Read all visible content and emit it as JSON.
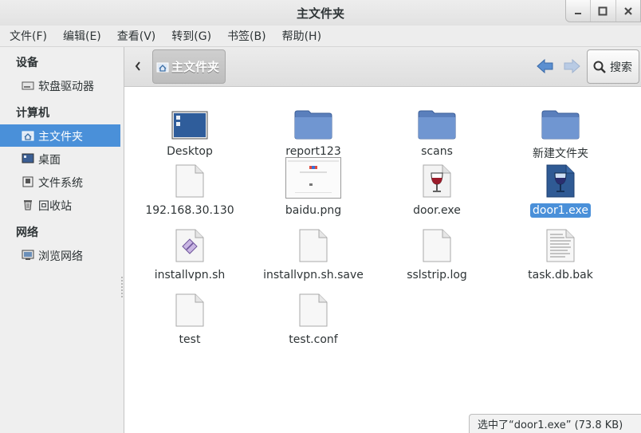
{
  "window": {
    "title": "主文件夹"
  },
  "menubar": [
    "文件(F)",
    "编辑(E)",
    "查看(V)",
    "转到(G)",
    "书签(B)",
    "帮助(H)"
  ],
  "sidebar": {
    "sections": [
      {
        "heading": "设备",
        "items": [
          {
            "label": "软盘驱动器",
            "icon": "floppy-drive-icon"
          }
        ]
      },
      {
        "heading": "计算机",
        "items": [
          {
            "label": "主文件夹",
            "icon": "home-folder-icon",
            "selected": true
          },
          {
            "label": "桌面",
            "icon": "desktop-icon"
          },
          {
            "label": "文件系统",
            "icon": "filesystem-icon"
          },
          {
            "label": "回收站",
            "icon": "trash-icon"
          }
        ]
      },
      {
        "heading": "网络",
        "items": [
          {
            "label": "浏览网络",
            "icon": "network-icon"
          }
        ]
      }
    ]
  },
  "location": {
    "path_label": "主文件夹",
    "search_label": "搜索"
  },
  "files": [
    {
      "name": "Desktop",
      "icon": "desktop-folder-icon"
    },
    {
      "name": "report123",
      "icon": "folder-icon"
    },
    {
      "name": "scans",
      "icon": "folder-icon"
    },
    {
      "name": "新建文件夹",
      "icon": "folder-icon"
    },
    {
      "name": "192.168.30.130",
      "icon": "blank-file-icon"
    },
    {
      "name": "baidu.png",
      "icon": "image-thumbnail-icon"
    },
    {
      "name": "door.exe",
      "icon": "wine-exe-icon"
    },
    {
      "name": "door1.exe",
      "icon": "wine-exe-icon",
      "selected": true
    },
    {
      "name": "installvpn.sh",
      "icon": "script-file-icon"
    },
    {
      "name": "installvpn.sh.save",
      "icon": "blank-file-icon"
    },
    {
      "name": "sslstrip.log",
      "icon": "blank-file-icon"
    },
    {
      "name": "task.db.bak",
      "icon": "text-file-icon"
    },
    {
      "name": "test",
      "icon": "blank-file-icon"
    },
    {
      "name": "test.conf",
      "icon": "blank-file-icon"
    }
  ],
  "status": "选中了“door1.exe” (73.8 KB)",
  "colors": {
    "selection": "#4a90d9",
    "folder": "#6a8fc8",
    "nav_arrow": "#5b8fd0"
  }
}
